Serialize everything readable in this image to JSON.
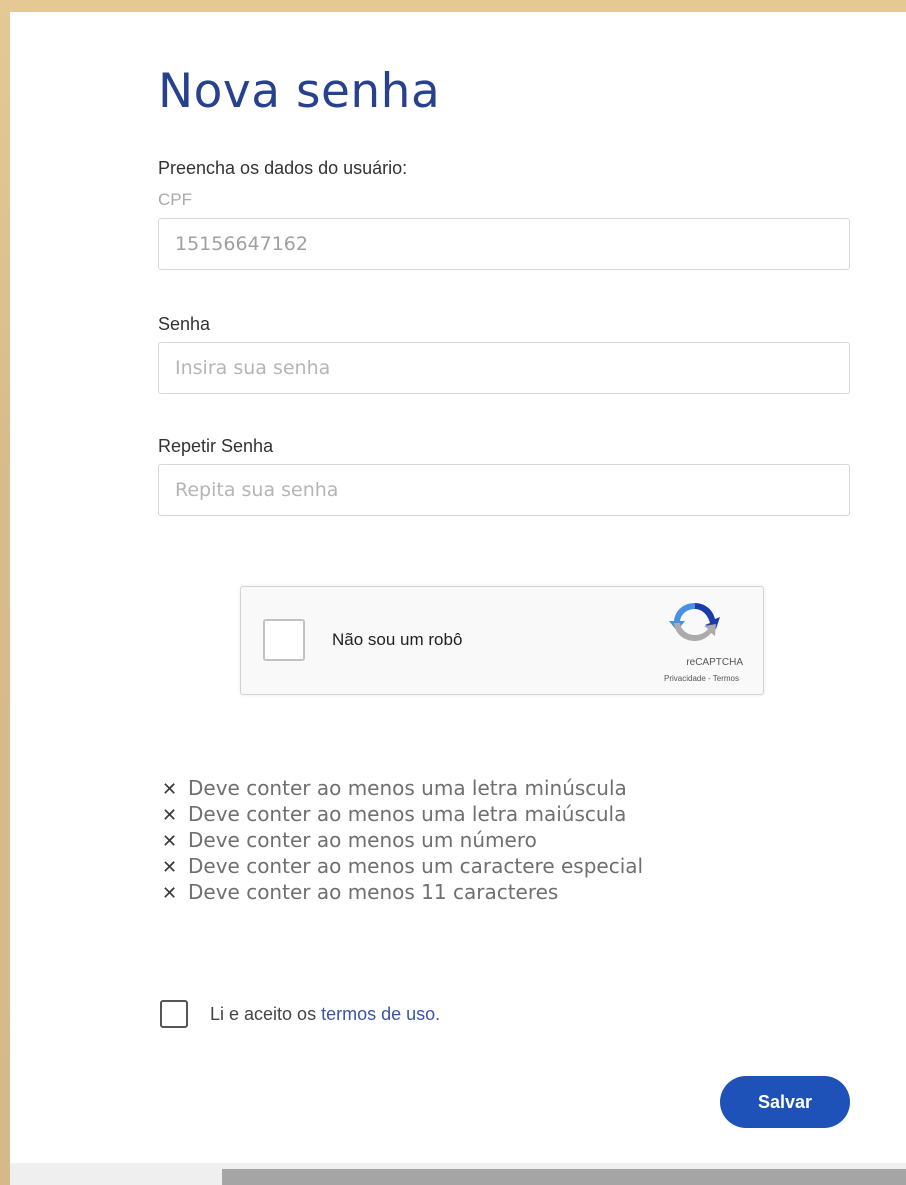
{
  "page": {
    "title": "Nova senha",
    "intro": "Preencha os dados do usuário:"
  },
  "form": {
    "cpf": {
      "label": "CPF",
      "value": "15156647162"
    },
    "password": {
      "label": "Senha",
      "placeholder": "Insira sua senha"
    },
    "repeat_password": {
      "label": "Repetir Senha",
      "placeholder": "Repita sua senha"
    }
  },
  "captcha": {
    "label": "Não sou um robô",
    "brand": "reCAPTCHA",
    "privacy": "Privacidade",
    "separator": " - ",
    "terms": "Termos"
  },
  "rules": [
    "Deve conter ao menos uma letra minúscula",
    "Deve conter ao menos uma letra maiúscula",
    "Deve conter ao menos um número",
    "Deve conter ao menos um caractere especial",
    "Deve conter ao menos 11 caracteres"
  ],
  "terms": {
    "text": "Li e aceito os",
    "link": "termos de uso.",
    "checked": false
  },
  "actions": {
    "save_label": "Salvar"
  },
  "colors": {
    "title": "#27418f",
    "primary_button": "#1e52b8",
    "link": "#3a55a8",
    "background": "#d8bb8c"
  },
  "icons": {
    "rule_status": "close-icon",
    "captcha_logo": "recaptcha-logo-icon"
  }
}
